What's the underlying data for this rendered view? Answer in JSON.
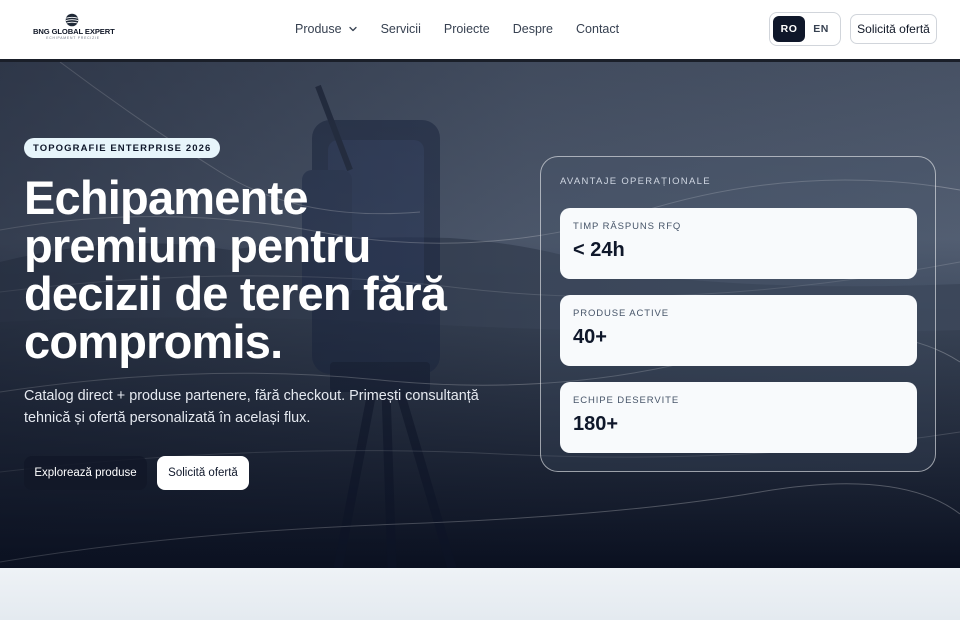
{
  "brand": {
    "name": "BNG GLOBAL EXPERT",
    "tagline": "ECHIPAMENT PRECIZIE",
    "logo_icon": "globe-icon"
  },
  "nav": {
    "items": [
      {
        "label": "Produse",
        "has_dropdown": true
      },
      {
        "label": "Servicii"
      },
      {
        "label": "Proiecte"
      },
      {
        "label": "Despre"
      },
      {
        "label": "Contact"
      }
    ]
  },
  "language": {
    "options": [
      "RO",
      "EN"
    ],
    "selected": "RO"
  },
  "header_cta": "Solicită ofertă",
  "hero": {
    "badge": "TOPOGRAFIE ENTERPRISE 2026",
    "title": "Echipamente premium pentru decizii de teren fără compromis.",
    "subtitle": "Catalog direct + produse partenere, fără checkout. Primești consultanță tehnică și ofertă personalizată în același flux.",
    "primary_button": "Explorează produse",
    "secondary_button": "Solicită ofertă"
  },
  "panel": {
    "title": "AVANTAJE OPERAȚIONALE",
    "stats": [
      {
        "label": "TIMP RĂSPUNS RFQ",
        "value": "< 24h"
      },
      {
        "label": "PRODUSE ACTIVE",
        "value": "40+"
      },
      {
        "label": "ECHIPE DESERVITE",
        "value": "180+"
      }
    ]
  },
  "colors": {
    "primary_dark": "#0f172a",
    "badge_bg": "#e7f5fb",
    "card_bg": "#f8fafc"
  }
}
